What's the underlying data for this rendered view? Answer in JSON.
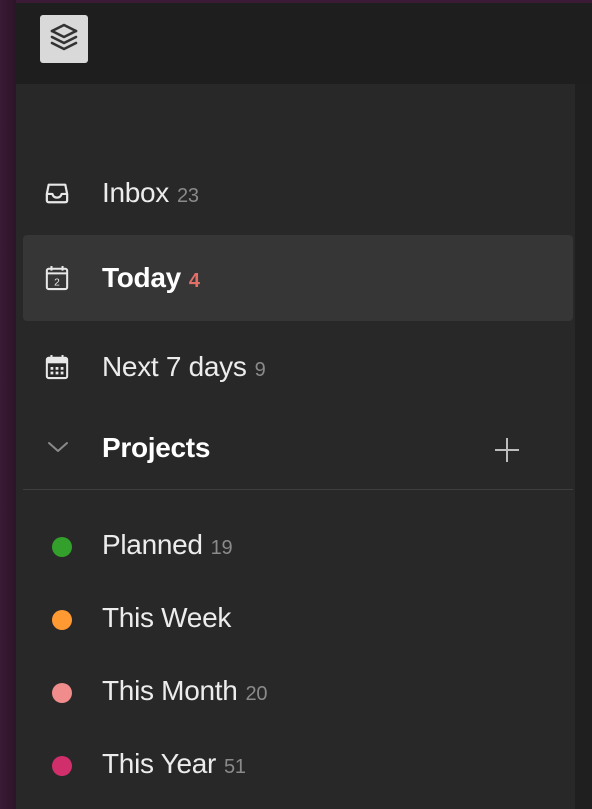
{
  "app": {
    "logo_icon": "layers-icon"
  },
  "nav": {
    "inbox": {
      "label": "Inbox",
      "count": "23",
      "icon": "inbox-icon"
    },
    "today": {
      "label": "Today",
      "count": "4",
      "icon": "calendar-today-icon",
      "date": "2",
      "count_color": "#e26e68"
    },
    "next7": {
      "label": "Next 7 days",
      "count": "9",
      "icon": "calendar-grid-icon"
    }
  },
  "projects": {
    "header": "Projects",
    "items": [
      {
        "label": "Planned",
        "count": "19",
        "color": "#33a02c"
      },
      {
        "label": "This Week",
        "count": "",
        "color": "#ff9a33"
      },
      {
        "label": "This Month",
        "count": "20",
        "color": "#f08c8c"
      },
      {
        "label": "This Year",
        "count": "51",
        "color": "#d12f6b"
      }
    ]
  }
}
